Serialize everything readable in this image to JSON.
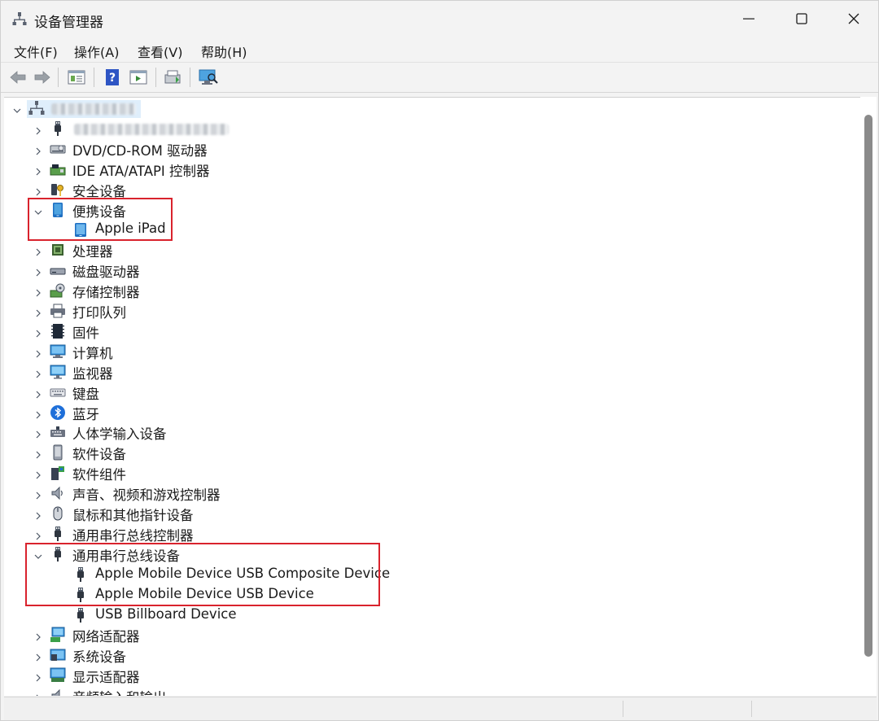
{
  "window": {
    "title": "设备管理器",
    "controls": {
      "minimize": "minimize",
      "maximize": "maximize",
      "close": "close"
    }
  },
  "menu": [
    {
      "label": "文件(F)"
    },
    {
      "label": "操作(A)"
    },
    {
      "label": "查看(V)"
    },
    {
      "label": "帮助(H)"
    }
  ],
  "toolbar": [
    {
      "icon": "back-arrow-icon"
    },
    {
      "icon": "forward-arrow-icon"
    },
    {
      "icon": "properties-icon"
    },
    {
      "icon": "help-icon"
    },
    {
      "icon": "run-icon"
    },
    {
      "icon": "update-driver-icon"
    },
    {
      "icon": "scan-hardware-icon"
    }
  ],
  "tree": {
    "root": {
      "label": "",
      "expanded": true
    },
    "items": [
      {
        "label": "",
        "expanded": false,
        "icon": "usb-plug-icon"
      },
      {
        "label": "DVD/CD-ROM 驱动器",
        "expanded": false,
        "icon": "dvd-drive-icon"
      },
      {
        "label": "IDE ATA/ATAPI 控制器",
        "expanded": false,
        "icon": "ide-controller-icon"
      },
      {
        "label": "安全设备",
        "expanded": false,
        "icon": "security-key-icon"
      },
      {
        "label": "便携设备",
        "expanded": true,
        "icon": "portable-device-icon",
        "children": [
          {
            "label": "Apple iPad",
            "icon": "tablet-icon"
          }
        ]
      },
      {
        "label": "处理器",
        "expanded": false,
        "icon": "processor-icon"
      },
      {
        "label": "磁盘驱动器",
        "expanded": false,
        "icon": "disk-drive-icon"
      },
      {
        "label": "存储控制器",
        "expanded": false,
        "icon": "storage-controller-icon"
      },
      {
        "label": "打印队列",
        "expanded": false,
        "icon": "printer-icon"
      },
      {
        "label": "固件",
        "expanded": false,
        "icon": "firmware-icon"
      },
      {
        "label": "计算机",
        "expanded": false,
        "icon": "computer-icon"
      },
      {
        "label": "监视器",
        "expanded": false,
        "icon": "monitor-icon"
      },
      {
        "label": "键盘",
        "expanded": false,
        "icon": "keyboard-icon"
      },
      {
        "label": "蓝牙",
        "expanded": false,
        "icon": "bluetooth-icon"
      },
      {
        "label": "人体学输入设备",
        "expanded": false,
        "icon": "hid-icon"
      },
      {
        "label": "软件设备",
        "expanded": false,
        "icon": "software-device-icon"
      },
      {
        "label": "软件组件",
        "expanded": false,
        "icon": "software-component-icon"
      },
      {
        "label": "声音、视频和游戏控制器",
        "expanded": false,
        "icon": "speaker-icon"
      },
      {
        "label": "鼠标和其他指针设备",
        "expanded": false,
        "icon": "mouse-icon"
      },
      {
        "label": "通用串行总线控制器",
        "expanded": false,
        "icon": "usb-plug-icon"
      },
      {
        "label": "通用串行总线设备",
        "expanded": true,
        "icon": "usb-plug-icon",
        "children": [
          {
            "label": "Apple Mobile Device USB Composite Device",
            "icon": "usb-plug-icon"
          },
          {
            "label": "Apple Mobile Device USB Device",
            "icon": "usb-plug-icon"
          },
          {
            "label": "USB Billboard Device",
            "icon": "usb-plug-icon"
          }
        ]
      },
      {
        "label": "网络适配器",
        "expanded": false,
        "icon": "network-adapter-icon"
      },
      {
        "label": "系统设备",
        "expanded": false,
        "icon": "system-device-icon"
      },
      {
        "label": "显示适配器",
        "expanded": false,
        "icon": "display-adapter-icon"
      },
      {
        "label": "音频输入和输出",
        "expanded": false,
        "icon": "audio-io-icon"
      }
    ]
  },
  "annotation_color": "#d9232d",
  "selection_color": "#dfeefb"
}
